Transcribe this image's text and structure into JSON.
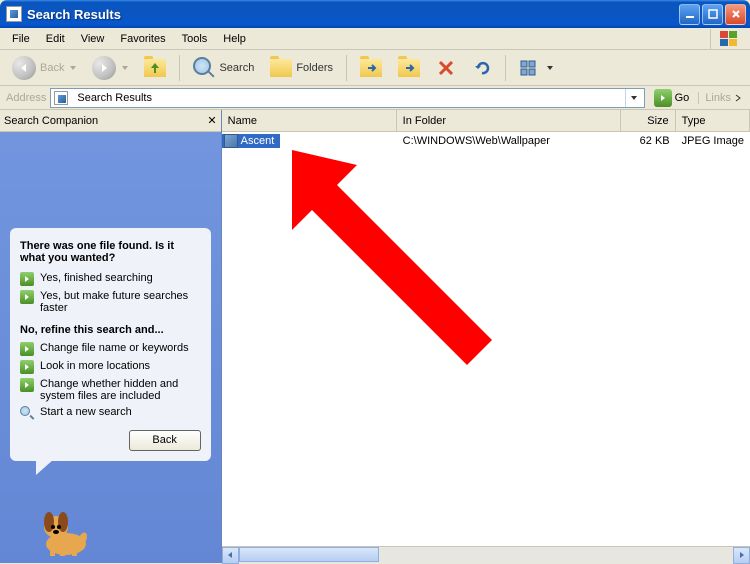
{
  "window": {
    "title": "Search Results"
  },
  "menu": {
    "items": [
      "File",
      "Edit",
      "View",
      "Favorites",
      "Tools",
      "Help"
    ]
  },
  "toolbar": {
    "back": "Back",
    "search": "Search",
    "folders": "Folders"
  },
  "addressbar": {
    "label": "Address",
    "value": "Search Results",
    "go": "Go",
    "links": "Links"
  },
  "sidebar": {
    "title": "Search Companion",
    "panel": {
      "heading": "There was one file found.  Is it what you wanted?",
      "yes_options": [
        "Yes, finished searching",
        "Yes, but make future searches faster"
      ],
      "refine_heading": "No, refine this search and...",
      "refine_options": [
        "Change file name or keywords",
        "Look in more locations",
        "Change whether hidden and system files are included"
      ],
      "new_search": "Start a new search",
      "back": "Back"
    }
  },
  "results": {
    "columns": {
      "name": "Name",
      "folder": "In Folder",
      "size": "Size",
      "type": "Type"
    },
    "rows": [
      {
        "name": "Ascent",
        "folder": "C:\\WINDOWS\\Web\\Wallpaper",
        "size": "62 KB",
        "type": "JPEG Image"
      }
    ]
  }
}
